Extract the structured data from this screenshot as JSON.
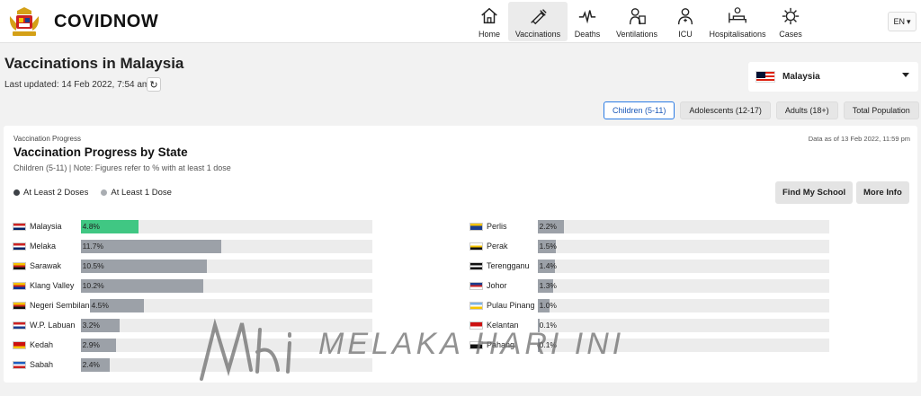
{
  "app": {
    "brand": "COVIDNOW"
  },
  "nav": [
    {
      "label": "Home",
      "icon": "home-icon",
      "w": 42
    },
    {
      "label": "Vaccinations",
      "icon": "syringe-icon",
      "w": 66,
      "active": true
    },
    {
      "label": "Deaths",
      "icon": "pulse-icon",
      "w": 44
    },
    {
      "label": "Ventilations",
      "icon": "ventilator-icon",
      "w": 66
    },
    {
      "label": "ICU",
      "icon": "doctor-icon",
      "w": 42
    },
    {
      "label": "Hospitalisations",
      "icon": "hospital-bed-icon",
      "w": 74
    },
    {
      "label": "Cases",
      "icon": "virus-icon",
      "w": 44
    }
  ],
  "lang": {
    "value": "EN"
  },
  "page": {
    "title": "Vaccinations in Malaysia",
    "updated": "Last updated: 14 Feb 2022, 7:54 am"
  },
  "country_select": {
    "value": "Malaysia"
  },
  "tabs": [
    {
      "label": "Children (5-11)",
      "active": true
    },
    {
      "label": "Adolescents (12-17)"
    },
    {
      "label": "Adults (18+)"
    },
    {
      "label": "Total Population"
    }
  ],
  "card": {
    "eyebrow": "Vaccination Progress",
    "title": "Vaccination Progress by State",
    "subtitle": "Children (5-11) | Note: Figures refer to % with at least 1 dose",
    "as_of": "Data as of 13 Feb 2022, 11:59 pm",
    "legend": [
      {
        "label": "At Least 2 Doses",
        "color": "#3d4147"
      },
      {
        "label": "At Least 1 Dose",
        "color": "#a9adb2"
      }
    ],
    "buttons": {
      "find_school": "Find My School",
      "more_info": "More Info"
    }
  },
  "states_left": [
    {
      "name": "Malaysia",
      "pct": "4.8%",
      "value": 4.8,
      "flag": [
        "#cc2222",
        "#ffffff",
        "#002266"
      ],
      "highlight": true
    },
    {
      "name": "Melaka",
      "pct": "11.7%",
      "value": 11.7,
      "flag": [
        "#cc2222",
        "#ffffff",
        "#002266"
      ]
    },
    {
      "name": "Sarawak",
      "pct": "10.5%",
      "value": 10.5,
      "flag": [
        "#f5c400",
        "#cc2222",
        "#111111"
      ]
    },
    {
      "name": "Klang Valley",
      "pct": "10.2%",
      "value": 10.2,
      "flag": [
        "#f5c400",
        "#cc2222",
        "#003399"
      ]
    },
    {
      "name": "Negeri Sembilan",
      "pct": "4.5%",
      "value": 4.5,
      "flag": [
        "#f5c400",
        "#cc2222",
        "#111111"
      ]
    },
    {
      "name": "W.P. Labuan",
      "pct": "3.2%",
      "value": 3.2,
      "flag": [
        "#cc2222",
        "#ffffff",
        "#1a3d8f"
      ]
    },
    {
      "name": "Kedah",
      "pct": "2.9%",
      "value": 2.9,
      "flag": [
        "#cc1111",
        "#cc1111",
        "#f5c400"
      ]
    },
    {
      "name": "Sabah",
      "pct": "2.4%",
      "value": 2.4,
      "flag": [
        "#1f5fbf",
        "#ffffff",
        "#cc2222"
      ]
    }
  ],
  "states_right": [
    {
      "name": "Perlis",
      "pct": "2.2%",
      "value": 2.2,
      "flag": [
        "#f5c400",
        "#1a3d8f",
        "#1a3d8f"
      ]
    },
    {
      "name": "Perak",
      "pct": "1.5%",
      "value": 1.5,
      "flag": [
        "#ffffff",
        "#f5c400",
        "#111111"
      ]
    },
    {
      "name": "Terengganu",
      "pct": "1.4%",
      "value": 1.4,
      "flag": [
        "#111111",
        "#ffffff",
        "#111111"
      ]
    },
    {
      "name": "Johor",
      "pct": "1.3%",
      "value": 1.3,
      "flag": [
        "#1a3d8f",
        "#cc2222",
        "#ffffff"
      ]
    },
    {
      "name": "Pulau Pinang",
      "pct": "1.0%",
      "value": 1.0,
      "flag": [
        "#7fb3e6",
        "#ffffff",
        "#f5c400"
      ]
    },
    {
      "name": "Kelantan",
      "pct": "0.1%",
      "value": 0.1,
      "flag": [
        "#cc1111",
        "#cc1111",
        "#ffffff"
      ]
    },
    {
      "name": "Pahang",
      "pct": "0.1%",
      "value": 0.1,
      "flag": [
        "#ffffff",
        "#111111",
        "#111111"
      ]
    }
  ],
  "watermark": {
    "text": "MELAKA HARI INI"
  },
  "colors": {
    "accent": "#2b7be4",
    "highlight": "#40c783",
    "bar": "#9ca1a8",
    "track": "#ececec"
  }
}
